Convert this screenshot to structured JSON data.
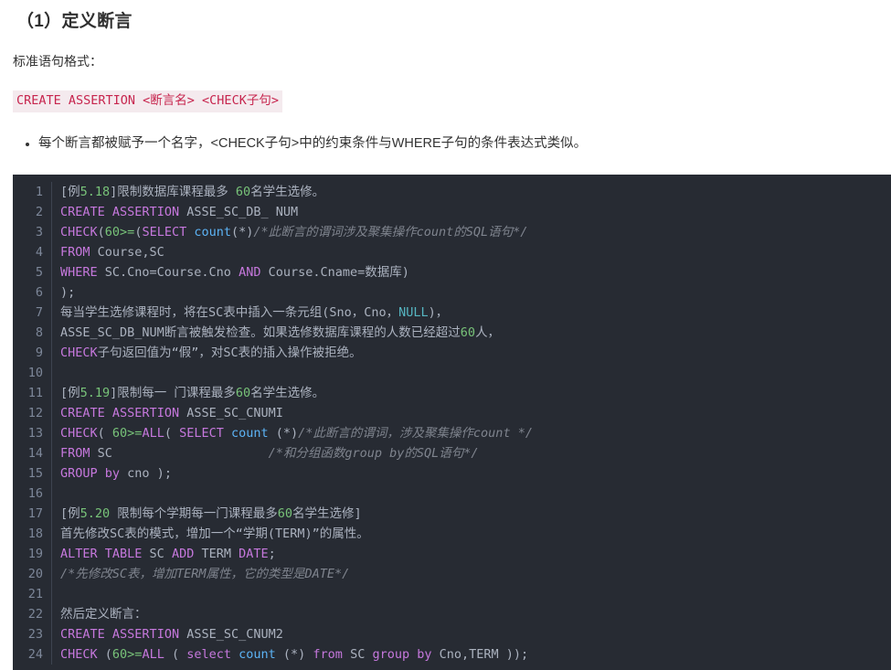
{
  "page": {
    "heading": "（1）定义断言",
    "intro_paragraph": "标准语句格式：",
    "syntax_code": "CREATE ASSERTION <断言名> <CHECK子句>",
    "bullets": [
      "每个断言都被赋予一个名字，<CHECK子句>中的约束条件与WHERE子句的条件表达式类似。"
    ]
  },
  "colors": {
    "code_background": "#272b33",
    "keyword": "#c678dd",
    "number": "#78c379",
    "function": "#5cb3f5",
    "constant": "#56b6c2",
    "comment": "#7f848e",
    "identifier": "#abb2bf",
    "line_number": "#7d8799",
    "inline_code_text": "#c7254e",
    "inline_code_background": "#f4eaee"
  },
  "code_block": {
    "line_numbers": [
      "1",
      "2",
      "3",
      "4",
      "5",
      "6",
      "7",
      "8",
      "9",
      "10",
      "11",
      "12",
      "13",
      "14",
      "15",
      "16",
      "17",
      "18",
      "19",
      "20",
      "21",
      "22",
      "23",
      "24"
    ],
    "lines": [
      {
        "n": "1",
        "plain": "[例5.18]限制数据库课程最多 60名学生选修。",
        "tokens": [
          {
            "t": "[例",
            "c": "id"
          },
          {
            "t": "5.18",
            "c": "num"
          },
          {
            "t": "]限制数据库课程最多 ",
            "c": "id"
          },
          {
            "t": "60",
            "c": "num"
          },
          {
            "t": "名学生选修。",
            "c": "id"
          }
        ]
      },
      {
        "n": "2",
        "plain": "CREATE ASSERTION ASSE_SC_DB_ NUM",
        "tokens": [
          {
            "t": "CREATE",
            "c": "kw"
          },
          {
            "t": " ",
            "c": "id"
          },
          {
            "t": "ASSERTION",
            "c": "kw"
          },
          {
            "t": " ASSE_SC_DB_ NUM",
            "c": "id"
          }
        ]
      },
      {
        "n": "3",
        "plain": "CHECK(60>=(SELECT count(*)/*此断言的谓词涉及聚集操作count的SQL语句*/",
        "tokens": [
          {
            "t": "CHECK",
            "c": "kw"
          },
          {
            "t": "(",
            "c": "id"
          },
          {
            "t": "60",
            "c": "num"
          },
          {
            "t": ">=",
            "c": "op"
          },
          {
            "t": "(",
            "c": "id"
          },
          {
            "t": "SELECT",
            "c": "kw"
          },
          {
            "t": " ",
            "c": "id"
          },
          {
            "t": "count",
            "c": "fn"
          },
          {
            "t": "(*)",
            "c": "id"
          },
          {
            "t": "/*此断言的谓词涉及聚集操作count的SQL语句*/",
            "c": "cm"
          }
        ]
      },
      {
        "n": "4",
        "plain": "FROM Course,SC",
        "tokens": [
          {
            "t": "FROM",
            "c": "kw"
          },
          {
            "t": " Course,SC",
            "c": "id"
          }
        ]
      },
      {
        "n": "5",
        "plain": "WHERE SC.Cno=Course.Cno AND Course.Cname=数据库)",
        "tokens": [
          {
            "t": "WHERE",
            "c": "kw"
          },
          {
            "t": " SC.Cno=Course.Cno ",
            "c": "id"
          },
          {
            "t": "AND",
            "c": "kw"
          },
          {
            "t": " Course.Cname=数据库)",
            "c": "id"
          }
        ]
      },
      {
        "n": "6",
        "plain": ");",
        "tokens": [
          {
            "t": ");",
            "c": "id"
          }
        ]
      },
      {
        "n": "7",
        "plain": "每当学生选修课程时，将在SC表中插入一条元组(Sno，Cno，NULL)，",
        "tokens": [
          {
            "t": "每当学生选修课程时，将在SC表中插入一条元组(Sno，Cno，",
            "c": "id"
          },
          {
            "t": "NULL",
            "c": "cy"
          },
          {
            "t": ")，",
            "c": "id"
          }
        ]
      },
      {
        "n": "8",
        "plain": "ASSE_SC_DB_NUM断言被触发检查。如果选修数据库课程的人数已经超过60人，",
        "tokens": [
          {
            "t": "ASSE_SC_DB_NUM断言被触发检查。如果选修数据库课程的人数已经超过",
            "c": "id"
          },
          {
            "t": "60",
            "c": "num"
          },
          {
            "t": "人，",
            "c": "id"
          }
        ]
      },
      {
        "n": "9",
        "plain": "CHECK子句返回值为“假”，对SC表的插入操作被拒绝。",
        "tokens": [
          {
            "t": "CHECK",
            "c": "kw"
          },
          {
            "t": "子句返回值为“假”，对SC表的插入操作被拒绝。",
            "c": "id"
          }
        ]
      },
      {
        "n": "10",
        "plain": "",
        "tokens": []
      },
      {
        "n": "11",
        "plain": "[例5.19]限制每一 门课程最多60名学生选修。",
        "tokens": [
          {
            "t": "[例",
            "c": "id"
          },
          {
            "t": "5.19",
            "c": "num"
          },
          {
            "t": "]限制每一 门课程最多",
            "c": "id"
          },
          {
            "t": "60",
            "c": "num"
          },
          {
            "t": "名学生选修。",
            "c": "id"
          }
        ]
      },
      {
        "n": "12",
        "plain": "CREATE ASSERTION ASSE_SC_CNUMI",
        "tokens": [
          {
            "t": "CREATE",
            "c": "kw"
          },
          {
            "t": " ",
            "c": "id"
          },
          {
            "t": "ASSERTION",
            "c": "kw"
          },
          {
            "t": " ASSE_SC_CNUMI",
            "c": "id"
          }
        ]
      },
      {
        "n": "13",
        "plain": "CHECK( 60>=ALL( SELECT count (*)/*此断言的谓词，涉及聚集操作count */",
        "tokens": [
          {
            "t": "CHECK",
            "c": "kw"
          },
          {
            "t": "( ",
            "c": "id"
          },
          {
            "t": "60",
            "c": "num"
          },
          {
            "t": ">=",
            "c": "op"
          },
          {
            "t": "ALL",
            "c": "kw"
          },
          {
            "t": "( ",
            "c": "id"
          },
          {
            "t": "SELECT",
            "c": "kw"
          },
          {
            "t": " ",
            "c": "id"
          },
          {
            "t": "count",
            "c": "fn"
          },
          {
            "t": " (*)",
            "c": "id"
          },
          {
            "t": "/*此断言的谓词，涉及聚集操作count */",
            "c": "cm"
          }
        ]
      },
      {
        "n": "14",
        "plain": "FROM SC                     /*和分组函数group by的SQL语句*/",
        "tokens": [
          {
            "t": "FROM",
            "c": "kw"
          },
          {
            "t": " SC",
            "c": "id"
          },
          {
            "t": "                     ",
            "c": "id"
          },
          {
            "t": "/*和分组函数group by的SQL语句*/",
            "c": "cm"
          }
        ]
      },
      {
        "n": "15",
        "plain": "GROUP by cno );",
        "tokens": [
          {
            "t": "GROUP",
            "c": "kw"
          },
          {
            "t": " ",
            "c": "id"
          },
          {
            "t": "by",
            "c": "kw"
          },
          {
            "t": " cno );",
            "c": "id"
          }
        ]
      },
      {
        "n": "16",
        "plain": "",
        "tokens": []
      },
      {
        "n": "17",
        "plain": "[例5.20 限制每个学期每一门课程最多60名学生选修]",
        "tokens": [
          {
            "t": "[例",
            "c": "id"
          },
          {
            "t": "5.20",
            "c": "num"
          },
          {
            "t": " 限制每个学期每一门课程最多",
            "c": "id"
          },
          {
            "t": "60",
            "c": "num"
          },
          {
            "t": "名学生选修]",
            "c": "id"
          }
        ]
      },
      {
        "n": "18",
        "plain": "首先修改SC表的模式，增加一个“学期(TERM)”的属性。",
        "tokens": [
          {
            "t": "首先修改SC表的模式，增加一个“学期(TERM)”的属性。",
            "c": "id"
          }
        ]
      },
      {
        "n": "19",
        "plain": "ALTER TABLE SC ADD TERM DATE;",
        "tokens": [
          {
            "t": "ALTER",
            "c": "kw"
          },
          {
            "t": " ",
            "c": "id"
          },
          {
            "t": "TABLE",
            "c": "kw"
          },
          {
            "t": " SC ",
            "c": "id"
          },
          {
            "t": "ADD",
            "c": "kw"
          },
          {
            "t": " TERM ",
            "c": "id"
          },
          {
            "t": "DATE",
            "c": "kw"
          },
          {
            "t": ";",
            "c": "id"
          }
        ]
      },
      {
        "n": "20",
        "plain": "/*先修改SC表，增加TERM属性，它的类型是DATE*/",
        "tokens": [
          {
            "t": "/*先修改SC表，增加TERM属性，它的类型是DATE*/",
            "c": "cm"
          }
        ]
      },
      {
        "n": "21",
        "plain": "",
        "tokens": []
      },
      {
        "n": "22",
        "plain": "然后定义断言：",
        "tokens": [
          {
            "t": "然后定义断言：",
            "c": "id"
          }
        ]
      },
      {
        "n": "23",
        "plain": "CREATE ASSERTION ASSE_SC_CNUM2",
        "tokens": [
          {
            "t": "CREATE",
            "c": "kw"
          },
          {
            "t": " ",
            "c": "id"
          },
          {
            "t": "ASSERTION",
            "c": "kw"
          },
          {
            "t": " ASSE_SC_CNUM2",
            "c": "id"
          }
        ]
      },
      {
        "n": "24",
        "plain": "CHECK (60>=ALL ( select count (*) from SC group by Cno,TERM ));",
        "tokens": [
          {
            "t": "CHECK",
            "c": "kw"
          },
          {
            "t": " (",
            "c": "id"
          },
          {
            "t": "60",
            "c": "num"
          },
          {
            "t": ">=",
            "c": "op"
          },
          {
            "t": "ALL",
            "c": "kw"
          },
          {
            "t": " ( ",
            "c": "id"
          },
          {
            "t": "select",
            "c": "kw"
          },
          {
            "t": " ",
            "c": "id"
          },
          {
            "t": "count",
            "c": "fn"
          },
          {
            "t": " (*) ",
            "c": "id"
          },
          {
            "t": "from",
            "c": "kw"
          },
          {
            "t": " SC ",
            "c": "id"
          },
          {
            "t": "group",
            "c": "kw"
          },
          {
            "t": " ",
            "c": "id"
          },
          {
            "t": "by",
            "c": "kw"
          },
          {
            "t": " Cno,TERM ));",
            "c": "id"
          }
        ]
      }
    ]
  }
}
